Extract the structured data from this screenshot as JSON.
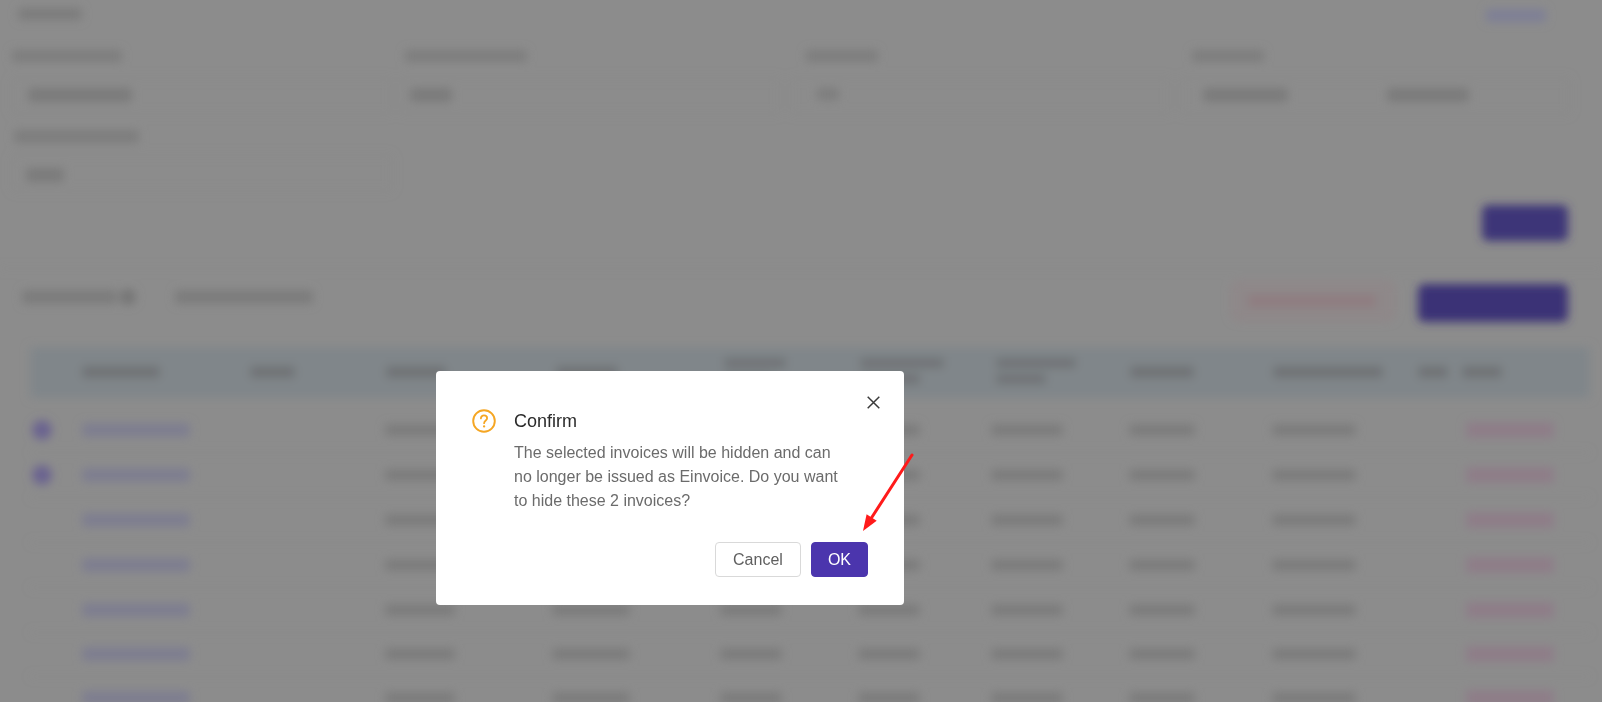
{
  "dialog": {
    "title": "Confirm",
    "message": "The selected invoices will be hidden and can no longer be issued as Einvoice. Do you want to hide these 2 invoices?",
    "buttons": [
      {
        "label": "Cancel",
        "kind": "default"
      },
      {
        "label": "OK",
        "kind": "primary"
      }
    ]
  }
}
